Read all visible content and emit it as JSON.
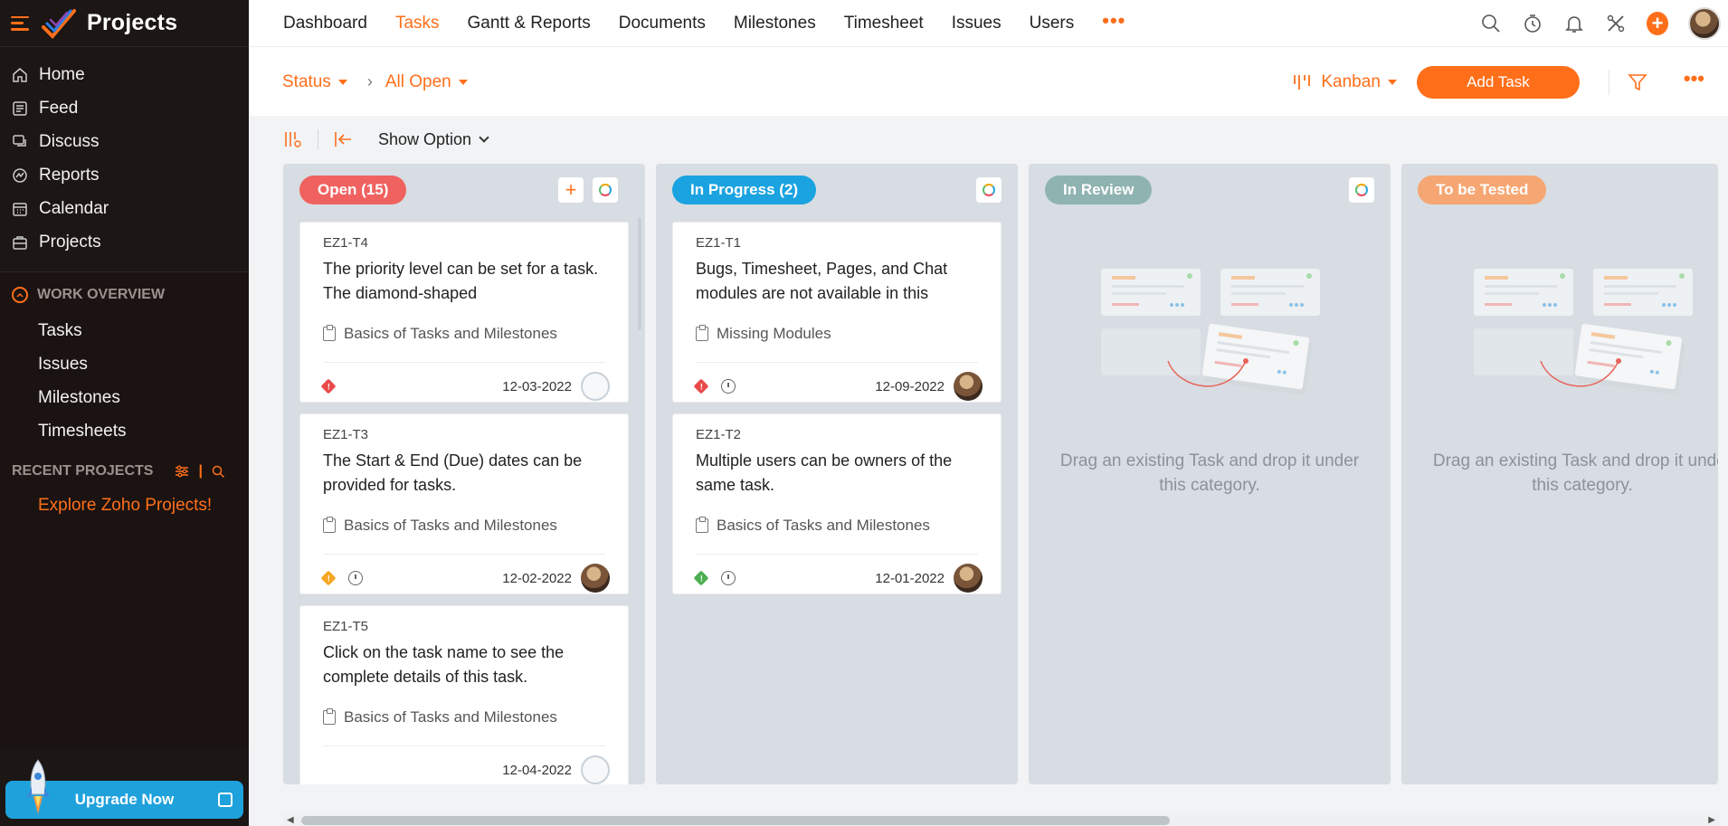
{
  "sidebar": {
    "app_title": "Projects",
    "nav": [
      {
        "label": "Home",
        "icon": "home-icon"
      },
      {
        "label": "Feed",
        "icon": "feed-icon"
      },
      {
        "label": "Discuss",
        "icon": "discuss-icon"
      },
      {
        "label": "Reports",
        "icon": "reports-icon"
      },
      {
        "label": "Calendar",
        "icon": "calendar-icon"
      },
      {
        "label": "Projects",
        "icon": "projects-icon"
      }
    ],
    "work_overview": {
      "heading": "WORK OVERVIEW",
      "items": [
        "Tasks",
        "Issues",
        "Milestones",
        "Timesheets"
      ]
    },
    "recent_projects": {
      "heading": "RECENT PROJECTS",
      "link": "Explore Zoho Projects!"
    },
    "upgrade_label": "Upgrade Now"
  },
  "topnav": {
    "tabs": [
      "Dashboard",
      "Tasks",
      "Gantt & Reports",
      "Documents",
      "Milestones",
      "Timesheet",
      "Issues",
      "Users"
    ],
    "active_tab": "Tasks",
    "more": "•••"
  },
  "subheader": {
    "filter_field": "Status",
    "filter_value": "All Open",
    "view": "Kanban",
    "add_task_label": "Add Task"
  },
  "toolbar": {
    "show_option_label": "Show Option"
  },
  "board": {
    "columns": [
      {
        "title": "Open (15)",
        "color": "#f0625f",
        "cards": [
          {
            "id": "EZ1-T4",
            "title": "The priority level can be set for a task. The diamond-shaped",
            "milestone": "Basics of Tasks and Milestones",
            "date": "12-03-2022",
            "priority_color": "#e84a4a",
            "timer": false,
            "owner": "empty"
          },
          {
            "id": "EZ1-T3",
            "title": "The Start & End (Due) dates can be provided for tasks.",
            "milestone": "Basics of Tasks and Milestones",
            "date": "12-02-2022",
            "priority_color": "#f5a623",
            "timer": true,
            "owner": "photo"
          },
          {
            "id": "EZ1-T5",
            "title": "Click on the task name to see the complete details of this task.",
            "milestone": "Basics of Tasks and Milestones",
            "date": "12-04-2022",
            "priority_color": "",
            "timer": false,
            "owner": "empty"
          }
        ]
      },
      {
        "title": "In Progress (2)",
        "color": "#1aa3e0",
        "cards": [
          {
            "id": "EZ1-T1",
            "title": "Bugs, Timesheet, Pages, and Chat modules are not available in this",
            "milestone": "Missing Modules",
            "date": "12-09-2022",
            "priority_color": "#e84a4a",
            "timer": true,
            "owner": "photo"
          },
          {
            "id": "EZ1-T2",
            "title": "Multiple users can be owners of the same task.",
            "milestone": "Basics of Tasks and Milestones",
            "date": "12-01-2022",
            "priority_color": "#4caf50",
            "timer": true,
            "owner": "photo"
          }
        ]
      },
      {
        "title": "In Review",
        "color": "#8fb3b1",
        "empty_text": "Drag an existing Task and drop it under this category."
      },
      {
        "title": "To be Tested",
        "color": "#f6a672",
        "empty_text": "Drag an existing Task and drop it under this category."
      }
    ]
  }
}
